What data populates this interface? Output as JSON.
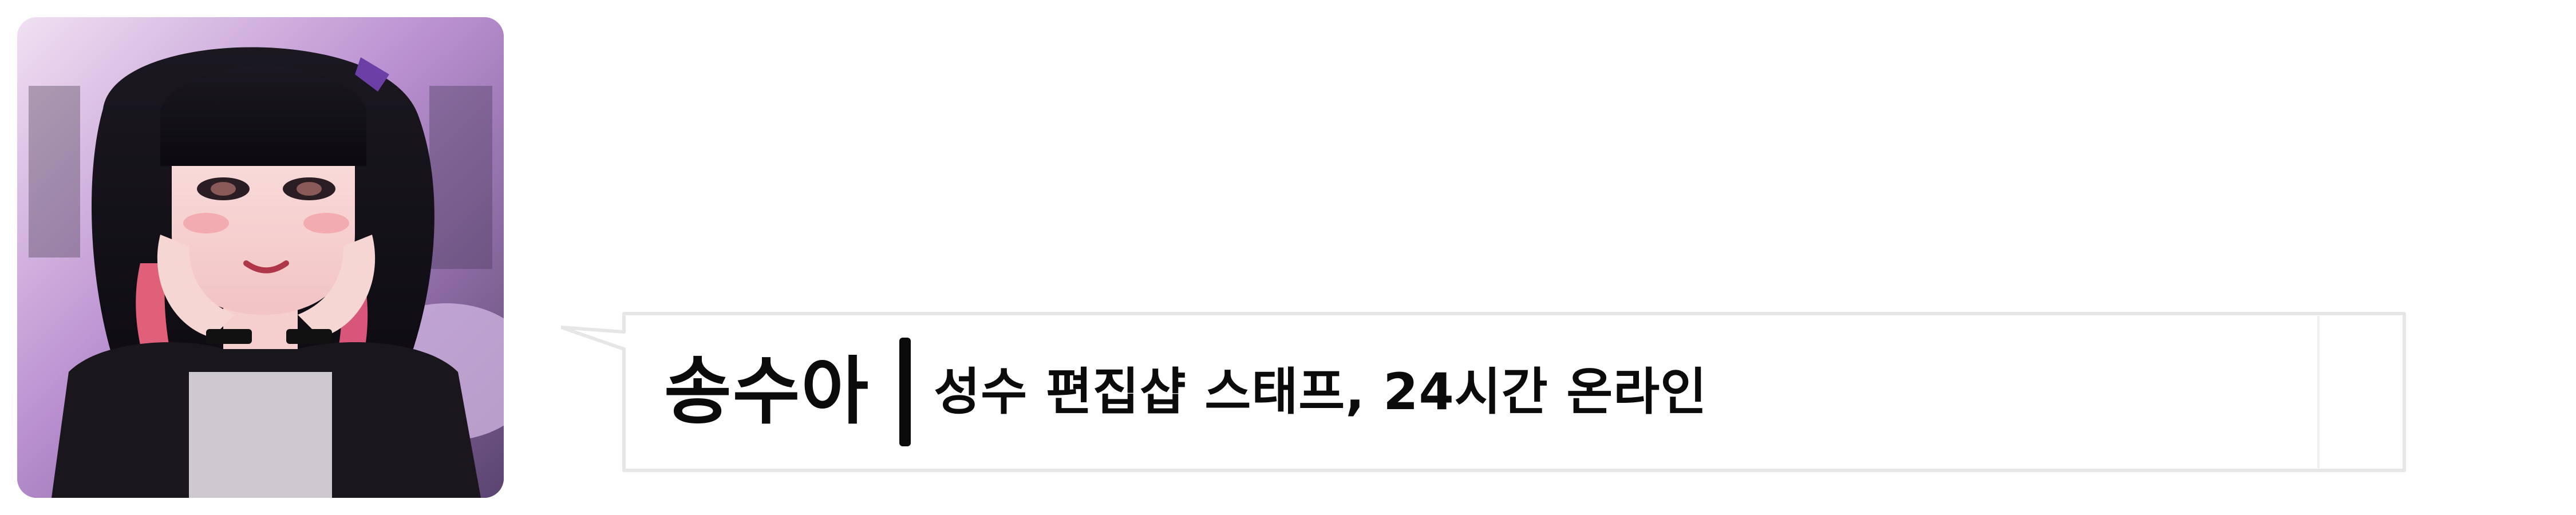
{
  "profile": {
    "name": "송수아",
    "status": "성수 편집샵 스태프, 24시간 온라인"
  },
  "colors": {
    "text": "#0b0b0b",
    "bubble_border": "#e6e6e6",
    "background": "#ffffff"
  }
}
